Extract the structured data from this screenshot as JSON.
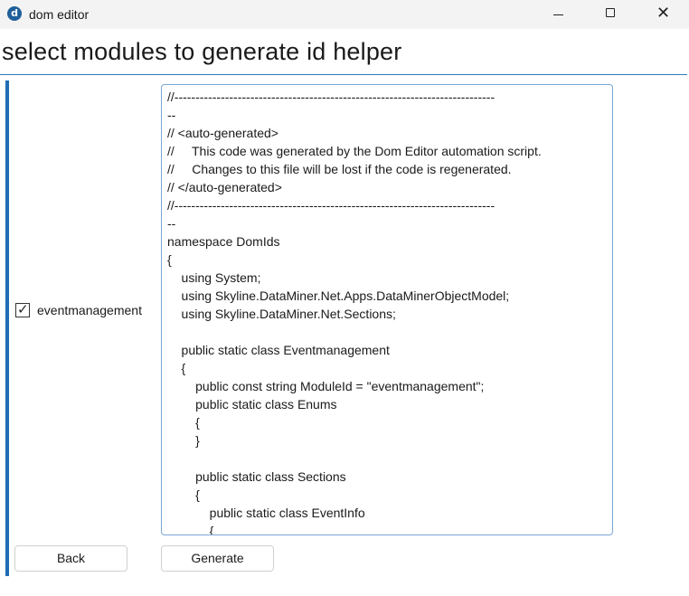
{
  "window": {
    "title": "dom editor",
    "icon_letter": "d",
    "minimize_glyph": "",
    "maximize_glyph": "",
    "close_glyph": "✕"
  },
  "page": {
    "heading": "select modules to generate id helper"
  },
  "modules": [
    {
      "name": "eventmanagement",
      "checked": true
    }
  ],
  "code": {
    "lines": [
      "//----------------------------------------------------------------------------",
      "--",
      "// <auto-generated>",
      "//     This code was generated by the Dom Editor automation script.",
      "//     Changes to this file will be lost if the code is regenerated.",
      "// </auto-generated>",
      "//----------------------------------------------------------------------------",
      "--",
      "namespace DomIds",
      "{",
      "    using System;",
      "    using Skyline.DataMiner.Net.Apps.DataMinerObjectModel;",
      "    using Skyline.DataMiner.Net.Sections;",
      "",
      "    public static class Eventmanagement",
      "    {",
      "        public const string ModuleId = \"eventmanagement\";",
      "        public static class Enums",
      "        {",
      "        }",
      "",
      "        public static class Sections",
      "        {",
      "            public static class EventInfo",
      "            {"
    ]
  },
  "buttons": {
    "back": "Back",
    "generate": "Generate"
  }
}
